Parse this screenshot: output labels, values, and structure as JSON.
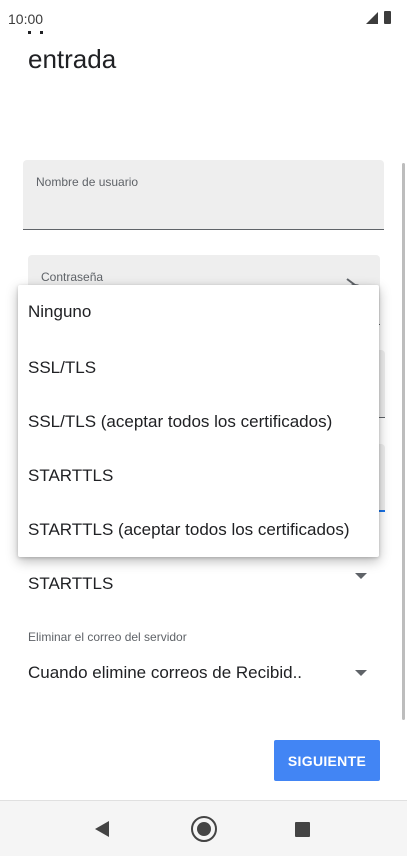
{
  "status_bar": {
    "time": "10:00",
    "icons": [
      "signal-icon",
      "battery-icon"
    ]
  },
  "page": {
    "title": "entrada"
  },
  "form": {
    "username_label": "Nombre de usuario",
    "username_value": "",
    "password_label": "Contraseña",
    "password_value": ""
  },
  "security_dropdown": {
    "options": [
      "Ninguno",
      "SSL/TLS",
      "SSL/TLS (aceptar todos los certificados)",
      "STARTTLS",
      "STARTTLS (aceptar todos los certificados)"
    ],
    "selected_value": "STARTTLS"
  },
  "delete_setting": {
    "label": "Eliminar el correo del servidor",
    "selected_value": "Cuando elimine correos de Recibid.."
  },
  "actions": {
    "next_label": "SIGUIENTE"
  },
  "colors": {
    "accent": "#4285f4",
    "focus_underline": "#1a73e8",
    "field_background": "#eeeeee"
  },
  "nav_bar": {
    "icons": [
      "back-icon",
      "home-icon",
      "recent-apps-icon"
    ]
  }
}
